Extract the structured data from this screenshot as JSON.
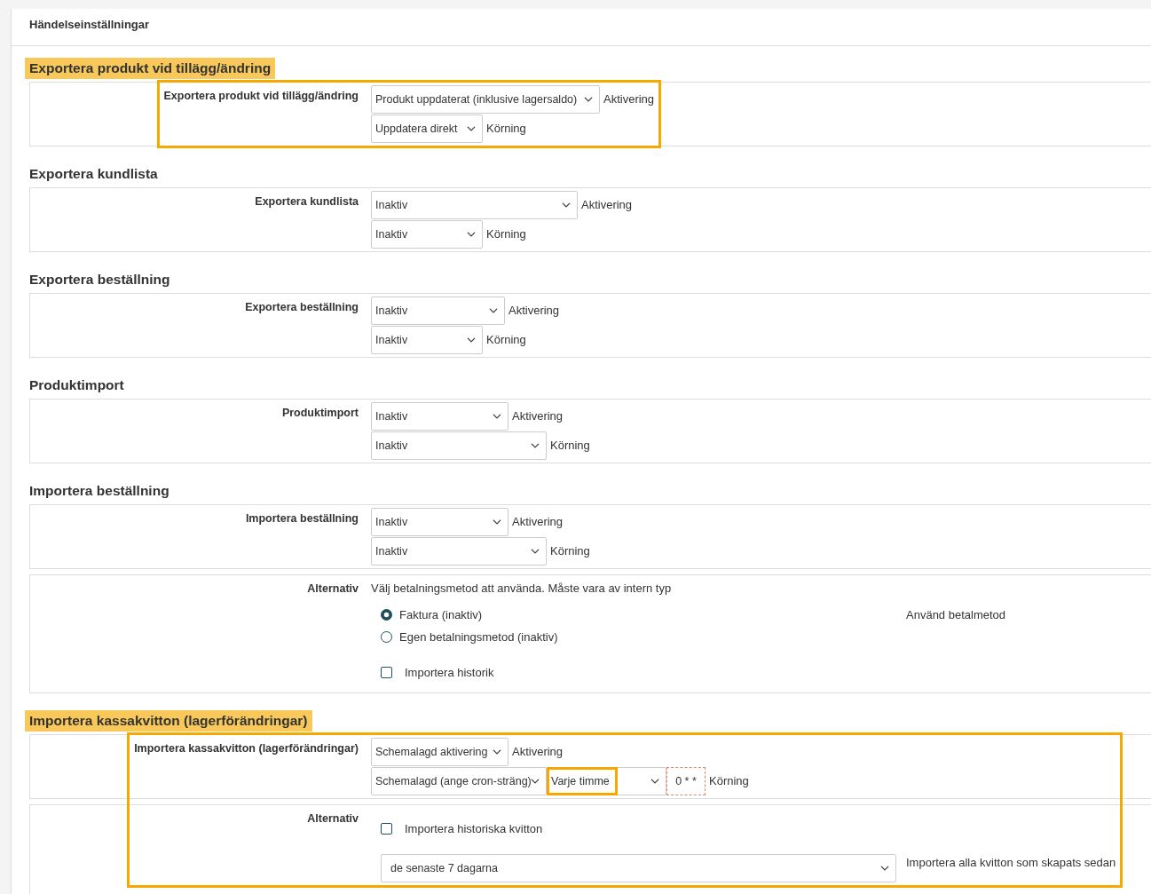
{
  "page_title": "Händelseinställningar",
  "sections": [
    {
      "title": "Exportera produkt vid tillägg/ändring",
      "highlighted": true,
      "panels": [
        {
          "kind": "trigger",
          "label": "Exportera produkt vid tillägg/ändring",
          "rows": [
            {
              "controls": [
                {
                  "kind": "select",
                  "value": "Produkt uppdaterat (inklusive lagersaldo)",
                  "highlighted": false
                }
              ],
              "caption": "Aktivering"
            },
            {
              "controls": [
                {
                  "kind": "select",
                  "value": "Uppdatera direkt",
                  "highlighted": false
                }
              ],
              "caption": "Körning"
            }
          ]
        }
      ]
    },
    {
      "title": "Exportera kundlista",
      "highlighted": false,
      "panels": [
        {
          "kind": "trigger",
          "label": "Exportera kundlista",
          "rows": [
            {
              "controls": [
                {
                  "kind": "select",
                  "value": "Inaktiv",
                  "highlighted": false
                }
              ],
              "caption": "Aktivering"
            },
            {
              "controls": [
                {
                  "kind": "select",
                  "value": "Inaktiv",
                  "highlighted": false
                }
              ],
              "caption": "Körning"
            }
          ]
        }
      ]
    },
    {
      "title": "Exportera beställning",
      "highlighted": false,
      "panels": [
        {
          "kind": "trigger",
          "label": "Exportera beställning",
          "rows": [
            {
              "controls": [
                {
                  "kind": "select",
                  "value": "Inaktiv",
                  "highlighted": false
                }
              ],
              "caption": "Aktivering"
            },
            {
              "controls": [
                {
                  "kind": "select",
                  "value": "Inaktiv",
                  "highlighted": false
                }
              ],
              "caption": "Körning"
            }
          ]
        }
      ]
    },
    {
      "title": "Produktimport",
      "highlighted": false,
      "panels": [
        {
          "kind": "trigger",
          "label": "Produktimport",
          "rows": [
            {
              "controls": [
                {
                  "kind": "select",
                  "value": "Inaktiv",
                  "highlighted": false
                }
              ],
              "caption": "Aktivering"
            },
            {
              "controls": [
                {
                  "kind": "select",
                  "value": "Inaktiv",
                  "highlighted": false
                }
              ],
              "caption": "Körning"
            }
          ]
        }
      ]
    },
    {
      "title": "Importera beställning",
      "highlighted": false,
      "panels": [
        {
          "kind": "trigger",
          "label": "Importera beställning",
          "rows": [
            {
              "controls": [
                {
                  "kind": "select",
                  "value": "Inaktiv",
                  "highlighted": false
                }
              ],
              "caption": "Aktivering"
            },
            {
              "controls": [
                {
                  "kind": "select",
                  "value": "Inaktiv",
                  "highlighted": false
                }
              ],
              "caption": "Körning"
            }
          ]
        },
        {
          "kind": "options",
          "label": "Alternativ",
          "items": [
            {
              "kind": "text",
              "text": "Välj betalningsmetod att använda. Måste vara av intern typ"
            },
            {
              "kind": "radio",
              "label": "Faktura (inaktiv)",
              "selected": true,
              "note": "Använd betalmetod"
            },
            {
              "kind": "radio",
              "label": "Egen betalningsmetod (inaktiv)",
              "selected": false
            },
            {
              "kind": "checkbox",
              "label": "Importera historik",
              "checked": false
            }
          ]
        }
      ]
    },
    {
      "title": "Importera kassakvitton (lagerförändringar)",
      "highlighted": true,
      "panels": [
        {
          "kind": "trigger",
          "label": "Importera kassakvitton (lagerförändringar)",
          "rows": [
            {
              "controls": [
                {
                  "kind": "select",
                  "value": "Schemalagd aktivering",
                  "highlighted": false
                }
              ],
              "caption": "Aktivering"
            },
            {
              "controls": [
                {
                  "kind": "select",
                  "value": "Schemalagd (ange cron-sträng)",
                  "highlighted": false
                },
                {
                  "kind": "select",
                  "value": "Varje timme",
                  "highlighted": true
                },
                {
                  "kind": "cron",
                  "value": "0 * *"
                }
              ],
              "caption": "Körning"
            }
          ]
        },
        {
          "kind": "options",
          "label": "Alternativ",
          "items": [
            {
              "kind": "checkbox",
              "label": "Importera historiska kvitton",
              "checked": false
            },
            {
              "kind": "select",
              "value": "de senaste 7 dagarna",
              "note": "Importera alla kvitton som skapats sedan"
            }
          ]
        }
      ]
    }
  ]
}
